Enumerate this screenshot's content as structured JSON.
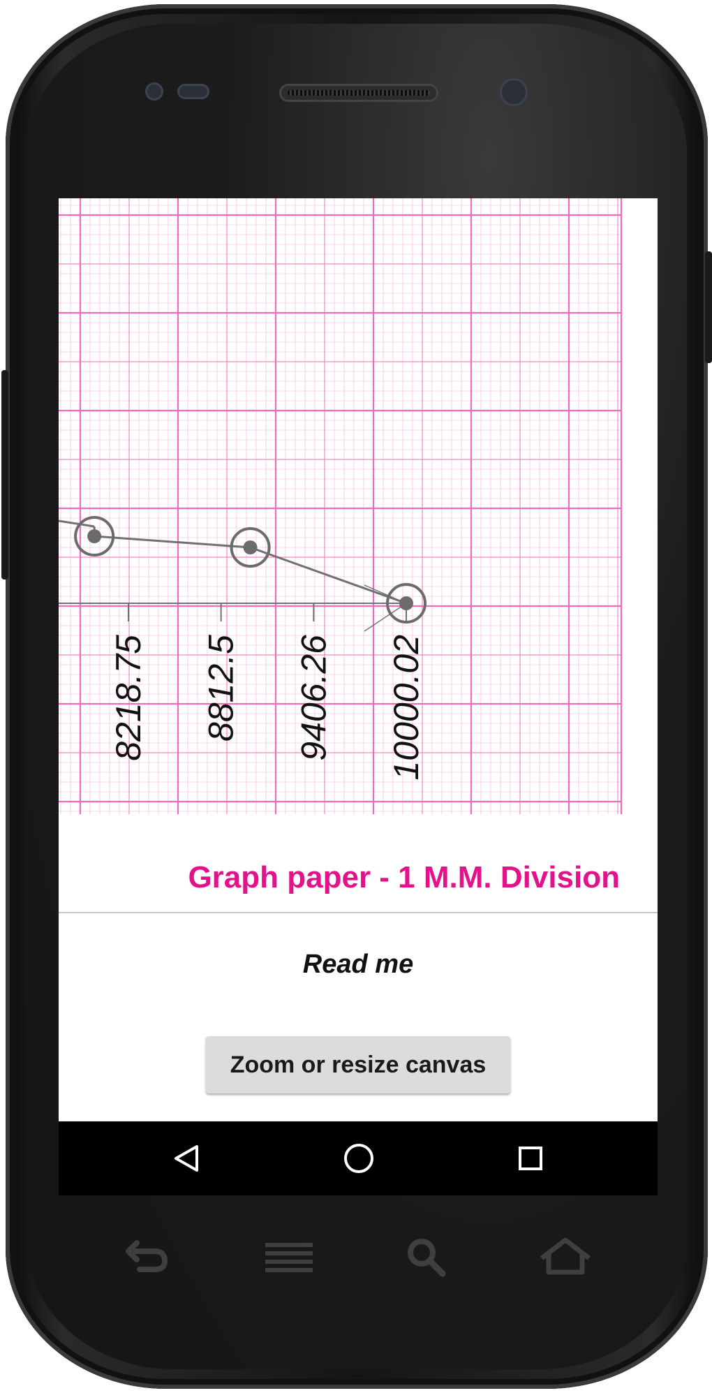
{
  "graph": {
    "title": "Graph paper - 1 M.M. Division",
    "grid_color": "#f06bb8",
    "line_color": "#707070",
    "point_color": "#6b6b6b"
  },
  "chart_data": {
    "type": "line",
    "x_tick_labels": [
      "8218.75",
      "8812.5",
      "9406.26",
      "10000.02"
    ],
    "x_ticks": [
      8218.75,
      8812.5,
      9406.26,
      10000.02
    ],
    "series": [
      {
        "points": [
          {
            "x": 8000,
            "y": 0.55
          },
          {
            "x": 8000,
            "y": 0.48
          },
          {
            "x": 9000,
            "y": 0.4
          },
          {
            "x": 10000.02,
            "y": 0.0
          }
        ]
      }
    ]
  },
  "actions": {
    "readme_label": "Read me",
    "zoom_label": "Zoom or resize canvas"
  },
  "navbar": {
    "back_icon": "back-triangle-icon",
    "home_icon": "home-circle-icon",
    "recents_icon": "recents-square-icon"
  },
  "hardware_keys": [
    "back-arrow-icon",
    "menu-lines-icon",
    "search-icon",
    "home-house-icon"
  ],
  "colors": {
    "accent": "#e3128a",
    "screen_bg": "#ffffff",
    "button_bg": "#dcdcdc"
  }
}
